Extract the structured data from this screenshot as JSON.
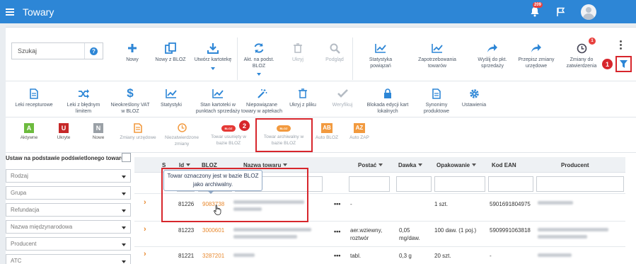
{
  "header": {
    "title": "Towary",
    "notification_count": "209"
  },
  "toolbar": {
    "search_placeholder": "Szukaj",
    "row1": [
      {
        "label": "Nowy",
        "icon": "plus-icon"
      },
      {
        "label": "Nowy z BLOZ",
        "icon": "copy-icon"
      },
      {
        "label": "Utwórz kartotekę",
        "icon": "download-icon"
      },
      {
        "label": "Akt. na podst. BLOZ",
        "icon": "refresh-icon"
      },
      {
        "label": "Ukryj",
        "icon": "trash-icon",
        "disabled": true
      },
      {
        "label": "Podgląd",
        "icon": "search-icon",
        "disabled": true
      },
      {
        "label": "Statystyka powiązań",
        "icon": "chart-icon"
      },
      {
        "label": "Zapotrzebowania towarów",
        "icon": "chart-icon"
      },
      {
        "label": "Wyślij do pkt. sprzedaży",
        "icon": "share-icon"
      },
      {
        "label": "Przepisz zmiany urzędowe",
        "icon": "share-icon"
      },
      {
        "label": "Zmiany do zatwierdzenia",
        "icon": "clock-icon",
        "badge": "1"
      }
    ],
    "row2": [
      {
        "label": "Leki recepturowe",
        "icon": "document-icon"
      },
      {
        "label": "Leki z błędnym limitem",
        "icon": "shuffle-icon"
      },
      {
        "label": "Nieokreślony VAT w BLOZ",
        "icon": "dollar-icon"
      },
      {
        "label": "Statystyki",
        "icon": "chart-icon"
      },
      {
        "label": "Stan kartoteki w punktach sprzedaży",
        "icon": "chart-icon"
      },
      {
        "label": "Niepowiązane towary w aptekach",
        "icon": "magic-icon"
      },
      {
        "label": "Ukryj z pliku",
        "icon": "trash-icon"
      },
      {
        "label": "Weryfikuj",
        "icon": "check-icon",
        "disabled": true
      },
      {
        "label": "Blokada edycji kart lokalnych",
        "icon": "lock-icon"
      },
      {
        "label": "Synonimy produktowe",
        "icon": "document-icon"
      },
      {
        "label": "Ustawienia",
        "icon": "gear-icon"
      }
    ]
  },
  "filters": [
    {
      "letter": "A",
      "label": "Aktywne",
      "color": "#6dbb3e"
    },
    {
      "letter": "U",
      "label": "Ukryte",
      "color": "#c62828"
    },
    {
      "letter": "N",
      "label": "Nowe",
      "color": "#9aa0a6"
    },
    {
      "label": "Zmiany urzędowe",
      "icon": "document-icon"
    },
    {
      "label": "Niezatwierdzone zmiany",
      "icon": "clock-icon"
    },
    {
      "label": "Towar usunięty w bazie BLOZ",
      "pill": "BLOZ",
      "color": "#e53935"
    },
    {
      "label": "Towar archiwalny w bazie BLOZ",
      "pill": "BLOZ",
      "color": "#f29a3f"
    },
    {
      "letter": "AB",
      "label": "Auto BLOZ",
      "color": "#f29a3f"
    },
    {
      "letter": "AZ",
      "label": "Auto ZAP",
      "color": "#f29a3f"
    }
  ],
  "left_panel": {
    "title": "Ustaw na podstawie podświetlonego towaru",
    "dropdowns": [
      "Rodzaj",
      "Grupa",
      "Refundacja",
      "Nazwa międzynarodowa",
      "Producent",
      "ATC"
    ]
  },
  "grid": {
    "columns": [
      "S",
      "Id",
      "BLOZ",
      "Nazwa towaru",
      "Postać",
      "Dawka",
      "Opakowanie",
      "Kod EAN",
      "Producent"
    ],
    "rows": [
      {
        "id": "81226",
        "bloz": "9083738",
        "postac": "-",
        "dawka": "",
        "opakowanie": "1 szt.",
        "ean": "5901691804975"
      },
      {
        "id": "81223",
        "bloz": "3000601",
        "postac": "aer.wziewny, roztwór",
        "dawka": "0,05 mg/daw.",
        "opakowanie": "100 daw. (1 poj.)",
        "ean": "5909991063818"
      },
      {
        "id": "81221",
        "bloz": "3287201",
        "postac": "tabl.",
        "dawka": "0,3 g",
        "opakowanie": "20 szt.",
        "ean": "-"
      }
    ]
  },
  "tooltip": "Towar oznaczony jest w bazie BLOZ jako archiwalny.",
  "callouts": [
    "1",
    "2"
  ]
}
